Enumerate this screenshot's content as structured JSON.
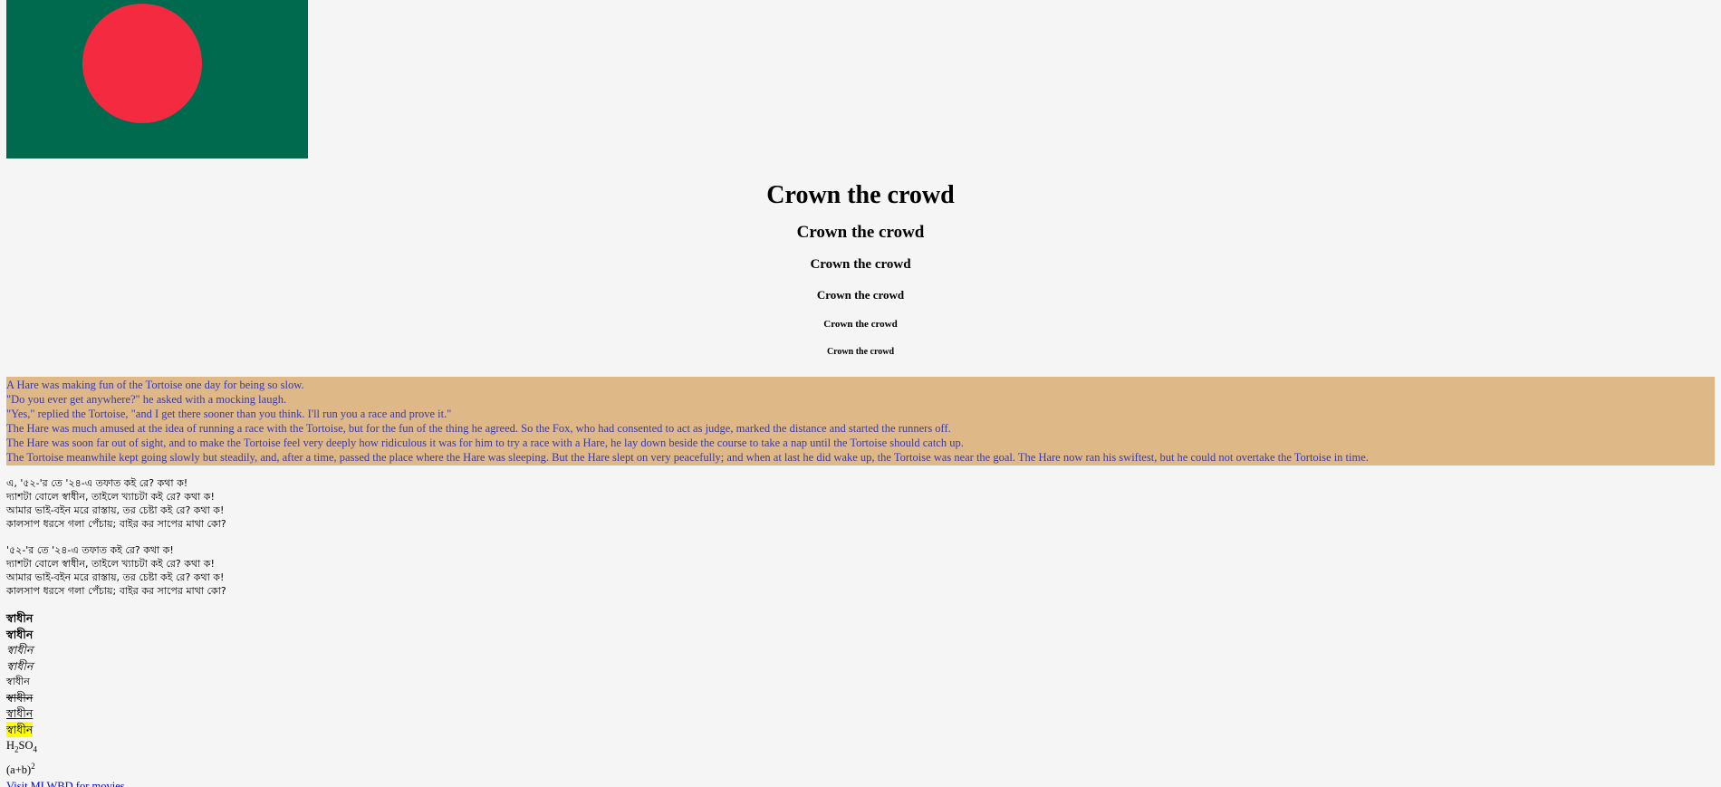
{
  "flag": {
    "green": "#006a4e",
    "red": "#f42a41"
  },
  "headings": [
    "Crown the crowd",
    "Crown the crowd",
    "Crown the crowd",
    "Crown the crowd",
    "Crown the crowd",
    "Crown the crowd"
  ],
  "story": {
    "background": "#deb887",
    "text_color": "#3a3ab0",
    "lines": [
      "A Hare was making fun of the Tortoise one day for being so slow.",
      "\"Do you ever get anywhere?\" he asked with a mocking laugh.",
      "\"Yes,\" replied the Tortoise, \"and I get there sooner than you think. I'll run you a race and prove it.\"",
      "The Hare was much amused at the idea of running a race with the Tortoise, but for the fun of the thing he agreed. So the Fox, who had consented to act as judge, marked the distance and started the runners off.",
      "The Hare was soon far out of sight, and to make the Tortoise feel very deeply how ridiculous it was for him to try a race with a Hare, he lay down beside the course to take a nap until the Tortoise should catch up.",
      "The Tortoise meanwhile kept going slowly but steadily, and, after a time, passed the place where the Hare was sleeping. But the Hare slept on very peacefully; and when at last he did wake up, the Tortoise was near the goal. The Hare now ran his swiftest, but he could not overtake the Tortoise in time."
    ]
  },
  "poems": [
    {
      "lines": [
        " এ, '৫২-'র তে '২৪-এ তফাত কই রে? কথা ক!",
        "দ্যাশটা বোলে স্বাধীন, তাইলে খ্যাচটা কই রে? কথা ক!",
        "আমার ভাই-বইন মরে রাস্তায়, তর চেষ্টা কই রে? কথা ক!",
        "কালসাপ ধরসে গলা পেঁচায়; বাইর কর সাপের মাথা কো?"
      ]
    },
    {
      "lines": [
        "'৫২-'র তে '২৪-এ তফাত কই রে? কথা ক!",
        "দ্যাশটা বোলে স্বাধীন, তাইলে খ্যাচটা কই রে? কথা ক!",
        "আমার ভাই-বইন মরে রাস্তায়, তর চেষ্টা কই রে? কথা ক!",
        "কালসাপ ধরসে গলা পেঁচায়; বাইর কর সাপের মাথা কো?"
      ]
    }
  ],
  "words": {
    "bold": "স্বাধীন",
    "strong": "স্বাধীন",
    "italic": "স্বাধীন",
    "em": "স্বাধীন",
    "small": "স্বাধীন",
    "del": "স্বাধীন",
    "ins": "স্বাধীন",
    "mark": "স্বাধীন"
  },
  "formulas": {
    "h2so4": {
      "h": "H",
      "two": "2",
      "so": "SO",
      "four": "4"
    },
    "ab2": {
      "base": "(a+b)",
      "exp": "2"
    }
  },
  "link": {
    "label": "Visit MLWBD for movies"
  }
}
